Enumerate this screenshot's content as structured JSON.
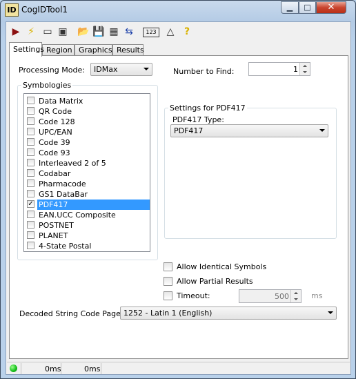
{
  "window": {
    "title": "CogIDTool1",
    "icon_text": "ID",
    "controls": {
      "minimize": "▁",
      "maximize": "□",
      "close": "✕"
    }
  },
  "toolbar": {
    "buttons": [
      {
        "name": "run-icon",
        "glyph": "▶"
      },
      {
        "name": "lightning-icon",
        "glyph": "⚡"
      },
      {
        "name": "camera-icon",
        "glyph": "▭"
      },
      {
        "name": "image-nav-icon",
        "glyph": "▣"
      },
      {
        "name": "open-folder-icon",
        "glyph": "📂"
      },
      {
        "name": "save-icon",
        "glyph": "💾"
      },
      {
        "name": "grid-icon",
        "glyph": "▦"
      },
      {
        "name": "import-icon",
        "glyph": "⇆"
      },
      {
        "name": "counter-icon",
        "glyph": "123"
      },
      {
        "name": "measure-icon",
        "glyph": "△"
      },
      {
        "name": "help-icon",
        "glyph": "?"
      }
    ]
  },
  "tabs": [
    "Settings",
    "Region",
    "Graphics",
    "Results"
  ],
  "settings": {
    "processing_mode_label": "Processing Mode:",
    "processing_mode_value": "IDMax",
    "number_to_find_label": "Number to Find:",
    "number_to_find_value": "1",
    "symbologies_label": "Symbologies",
    "symbologies": [
      {
        "label": "Data Matrix",
        "checked": false
      },
      {
        "label": "QR Code",
        "checked": false
      },
      {
        "label": "Code 128",
        "checked": false
      },
      {
        "label": "UPC/EAN",
        "checked": false
      },
      {
        "label": "Code 39",
        "checked": false
      },
      {
        "label": "Code 93",
        "checked": false
      },
      {
        "label": "Interleaved 2 of 5",
        "checked": false
      },
      {
        "label": "Codabar",
        "checked": false
      },
      {
        "label": "Pharmacode",
        "checked": false
      },
      {
        "label": "GS1 DataBar",
        "checked": false
      },
      {
        "label": "PDF417",
        "checked": true,
        "selected": true
      },
      {
        "label": "EAN.UCC Composite",
        "checked": false
      },
      {
        "label": "POSTNET",
        "checked": false
      },
      {
        "label": "PLANET",
        "checked": false
      },
      {
        "label": "4-State Postal",
        "checked": false
      }
    ],
    "settings_for_label": "Settings for PDF417",
    "pdf417_type_label": "PDF417 Type:",
    "pdf417_type_value": "PDF417",
    "allow_identical_label": "Allow Identical Symbols",
    "allow_partial_label": "Allow Partial Results",
    "timeout_label": "Timeout:",
    "timeout_value": "500",
    "timeout_unit": "ms",
    "code_page_label": "Decoded String Code Page:",
    "code_page_value": "1252 - Latin 1 (English)"
  },
  "status": {
    "time1": "0ms",
    "time2": "0ms"
  }
}
